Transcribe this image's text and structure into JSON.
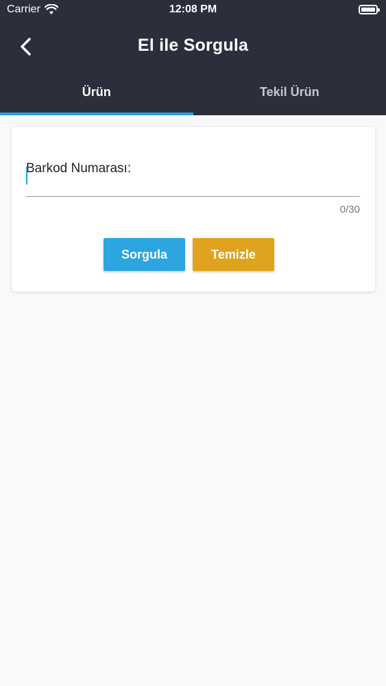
{
  "status_bar": {
    "carrier": "Carrier",
    "time": "12:08 PM",
    "wifi_icon": "wifi-icon",
    "battery_icon": "battery-icon"
  },
  "nav": {
    "back_icon": "chevron-left-icon",
    "title": "El ile Sorgula"
  },
  "tabs": [
    {
      "label": "Ürün",
      "active": true
    },
    {
      "label": "Tekil Ürün",
      "active": false
    }
  ],
  "form": {
    "barcode_label": "Barkod Numarası:",
    "barcode_value": "",
    "counter": "0/30",
    "query_button": "Sorgula",
    "clear_button": "Temizle"
  },
  "colors": {
    "header_bg": "#2b2f3b",
    "accent": "#2a9fde",
    "query_button": "#2ca6e0",
    "clear_button": "#e0a31d"
  }
}
